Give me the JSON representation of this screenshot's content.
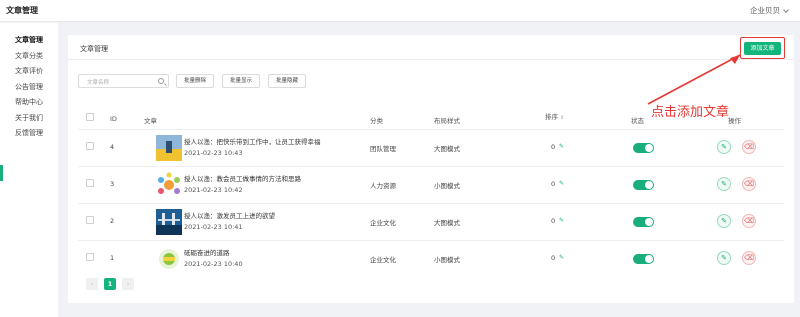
{
  "header": {
    "title": "文章管理",
    "user": "企业贝贝"
  },
  "sidebar": {
    "items": [
      {
        "label": "文章管理",
        "active": true
      },
      {
        "label": "文章分类"
      },
      {
        "label": "文章评价"
      },
      {
        "label": "公告管理"
      },
      {
        "label": "帮助中心"
      },
      {
        "label": "关于我们"
      },
      {
        "label": "反馈管理"
      }
    ]
  },
  "card": {
    "title": "文章管理",
    "add_button": "添加文章",
    "search_placeholder": "文章名称",
    "filters": [
      "批量删除",
      "批量显示",
      "批量隐藏"
    ]
  },
  "table": {
    "columns": {
      "id": "ID",
      "article": "文章",
      "category": "分类",
      "layout": "布局样式",
      "sort": "排序",
      "status": "状态",
      "actions": "操作"
    },
    "rows": [
      {
        "id": "4",
        "title": "授人以渔：把快乐带到工作中，让员工获得幸福",
        "date": "2021-02-23 10:43",
        "category": "团队管理",
        "layout": "大图模式",
        "sort": "0",
        "status_on": true,
        "thumb": "image-icon"
      },
      {
        "id": "3",
        "title": "授人以渔：教会员工做事情的方法和思路",
        "date": "2021-02-23 10:42",
        "category": "人力资源",
        "layout": "小图模式",
        "sort": "0",
        "status_on": true,
        "thumb": "image-icon"
      },
      {
        "id": "2",
        "title": "授人以渔：激发员工上进的欲望",
        "date": "2021-02-23 10:41",
        "category": "企业文化",
        "layout": "大图模式",
        "sort": "0",
        "status_on": true,
        "thumb": "image-icon"
      },
      {
        "id": "1",
        "title": "砥砺奋进的道路",
        "date": "2021-02-23 10:40",
        "category": "企业文化",
        "layout": "小图模式",
        "sort": "0",
        "status_on": true,
        "thumb": "image-icon"
      }
    ]
  },
  "pagination": {
    "current": "1"
  },
  "annotation": {
    "text": "点击添加文章"
  },
  "colors": {
    "accent": "#14b57c",
    "annotation": "#e53935"
  }
}
